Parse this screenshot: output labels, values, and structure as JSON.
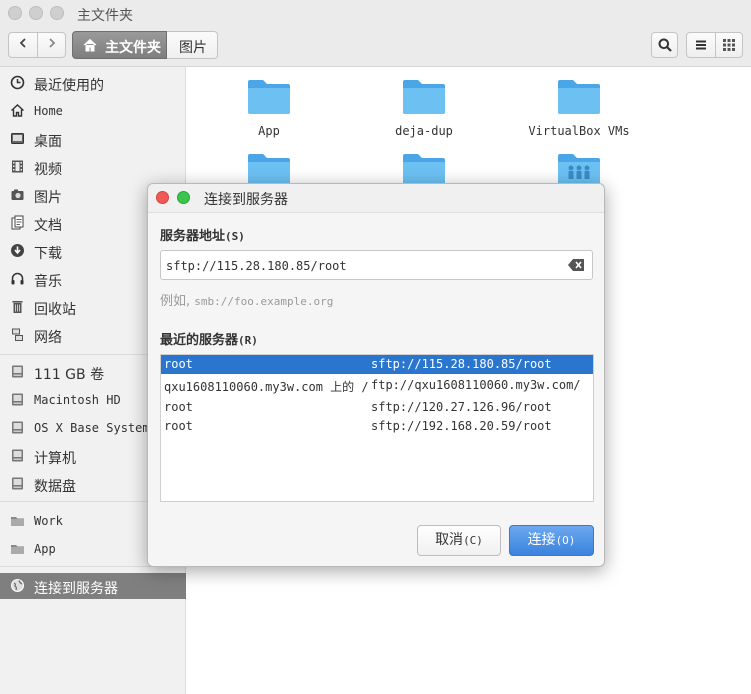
{
  "window": {
    "title": "主文件夹"
  },
  "toolbar": {
    "back_icon": "chevron-left-icon",
    "forward_icon": "chevron-right-icon",
    "breadcrumbs": [
      {
        "label": "主文件夹",
        "icon": "home-icon"
      },
      {
        "label": "图片"
      }
    ],
    "search_icon": "search-icon",
    "list_view_icon": "list-view-icon",
    "grid_view_icon": "grid-view-icon"
  },
  "sidebar": {
    "places": [
      {
        "label": "最近使用的",
        "icon": "clock-icon"
      },
      {
        "label": "Home",
        "icon": "home-icon"
      },
      {
        "label": "桌面",
        "icon": "desktop-icon"
      },
      {
        "label": "视频",
        "icon": "film-icon"
      },
      {
        "label": "图片",
        "icon": "camera-icon"
      },
      {
        "label": "文档",
        "icon": "document-icon"
      },
      {
        "label": "下载",
        "icon": "download-icon"
      },
      {
        "label": "音乐",
        "icon": "headphones-icon"
      },
      {
        "label": "回收站",
        "icon": "trash-icon"
      },
      {
        "label": "网络",
        "icon": "network-icon"
      }
    ],
    "devices": [
      {
        "label": "111 GB 卷",
        "icon": "drive-icon"
      },
      {
        "label": "Macintosh HD",
        "icon": "drive-icon"
      },
      {
        "label": "OS X Base System",
        "icon": "drive-icon"
      },
      {
        "label": "计算机",
        "icon": "drive-icon"
      },
      {
        "label": "数据盘",
        "icon": "drive-icon"
      }
    ],
    "bookmarks": [
      {
        "label": "Work",
        "icon": "folder-icon"
      },
      {
        "label": "App",
        "icon": "folder-icon"
      }
    ],
    "connect": {
      "label": "连接到服务器",
      "icon": "globe-icon"
    }
  },
  "files": [
    {
      "name": "App"
    },
    {
      "name": "deja-dup"
    },
    {
      "name": "VirtualBox VMs"
    },
    {
      "name": ""
    },
    {
      "name": ""
    },
    {
      "name": ""
    }
  ],
  "dialog": {
    "title": "连接到服务器",
    "server_address_label": "服务器地址",
    "server_address_key": "(S)",
    "server_address_value": "sftp://115.28.180.85/root",
    "example_prefix": "例如,",
    "example_value": "smb://foo.example.org",
    "recent_label": "最近的服务器",
    "recent_key": "(R)",
    "recent_servers": [
      {
        "name": "root",
        "uri": "sftp://115.28.180.85/root",
        "selected": true
      },
      {
        "name": "qxu1608110060.my3w.com 上的 /",
        "uri": "ftp://qxu1608110060.my3w.com/",
        "selected": false
      },
      {
        "name": "root",
        "uri": "sftp://120.27.126.96/root",
        "selected": false
      },
      {
        "name": "root",
        "uri": "sftp://192.168.20.59/root",
        "selected": false
      }
    ],
    "cancel_label": "取消",
    "cancel_key": "(C)",
    "connect_label": "连接",
    "connect_key": "(O)"
  },
  "colors": {
    "accent": "#2a76cf",
    "folder": "#5db8f0",
    "connect_button": "#4a8fe4"
  }
}
